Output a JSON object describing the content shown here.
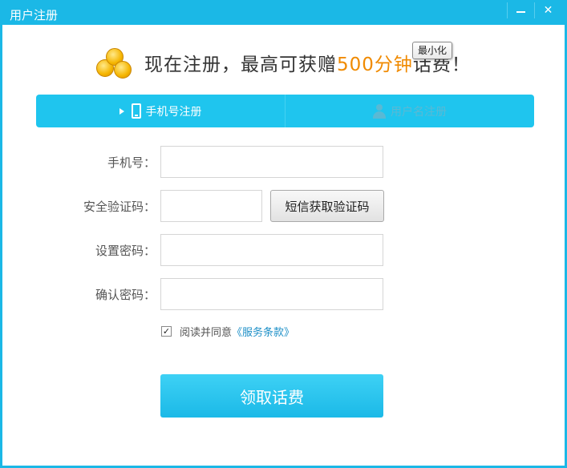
{
  "window": {
    "title": "用户注册",
    "close_glyph": "✕",
    "accent_color": "#1bb8e6"
  },
  "tooltip": {
    "text": "最小化"
  },
  "promo": {
    "text_before": "现在注册，最高可获赠",
    "highlight": "500分钟",
    "text_after": "话费！",
    "icon": "gold-coins-icon",
    "highlight_color": "#f08a00"
  },
  "tabs": [
    {
      "label": "手机号注册",
      "icon": "mobile-phone-icon",
      "active": true
    },
    {
      "label": "用户名注册",
      "icon": "user-icon",
      "active": false
    }
  ],
  "form": {
    "phone": {
      "label": "手机号：",
      "value": ""
    },
    "code": {
      "label": "安全验证码：",
      "value": "",
      "button": "短信获取验证码"
    },
    "password": {
      "label": "设置密码：",
      "value": ""
    },
    "confirm": {
      "label": "确认密码：",
      "value": ""
    }
  },
  "agreement": {
    "checked": true,
    "check_glyph": "✓",
    "text": "阅读并同意",
    "link": "《服务条款》"
  },
  "submit": {
    "label": "领取话费"
  }
}
